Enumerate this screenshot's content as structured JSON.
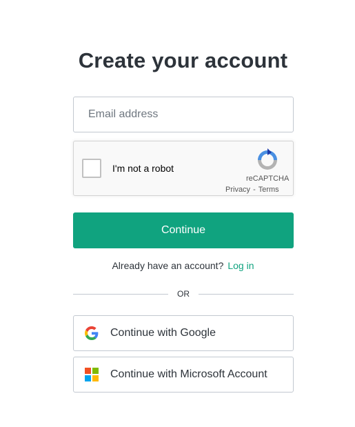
{
  "heading": "Create your account",
  "email": {
    "placeholder": "Email address",
    "value": ""
  },
  "recaptcha": {
    "checkbox_label": "I'm not a robot",
    "brand": "reCAPTCHA",
    "privacy_label": "Privacy",
    "separator": "-",
    "terms_label": "Terms",
    "icon": "recaptcha-logo"
  },
  "continue_label": "Continue",
  "login_prompt": {
    "text": "Already have an account?",
    "link": "Log in"
  },
  "divider_label": "OR",
  "social": {
    "google_label": "Continue with Google",
    "microsoft_label": "Continue with Microsoft Account",
    "google_icon": "google-logo",
    "microsoft_icon": "microsoft-logo"
  },
  "colors": {
    "accent": "#10a37f",
    "text": "#2d333a",
    "border": "#c2c8d0",
    "ms_red": "#f25022",
    "ms_green": "#7fba00",
    "ms_blue": "#00a4ef",
    "ms_yellow": "#ffb900"
  }
}
